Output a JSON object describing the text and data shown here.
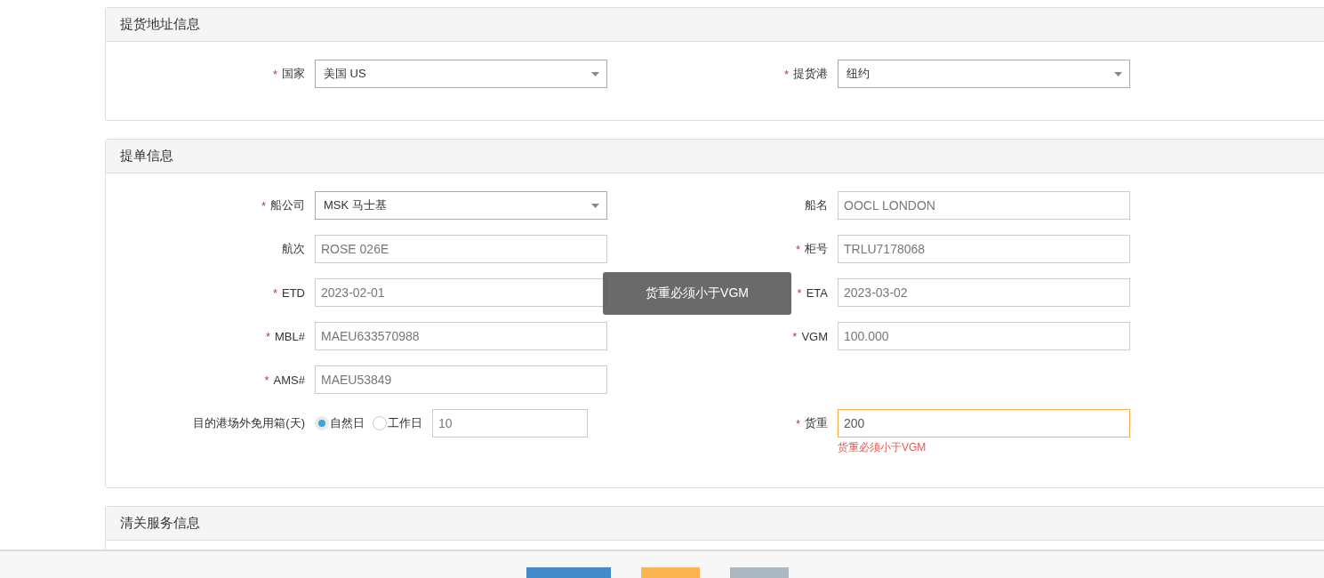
{
  "panels": [
    {
      "title": "提货地址信息",
      "rows": [
        {
          "left": {
            "kind": "select",
            "mark": "*",
            "label": "国家",
            "value": "美国 US"
          },
          "right": {
            "kind": "select",
            "mark": "*",
            "label": "提货港",
            "value": "纽约"
          }
        }
      ]
    },
    {
      "title": "提单信息",
      "rows": [
        {
          "left": {
            "kind": "select",
            "mark": "*",
            "label": "船公司",
            "value": "MSK 马士基"
          },
          "right": {
            "kind": "input",
            "label": "船名",
            "value": "OOCL LONDON"
          }
        },
        {
          "left": {
            "kind": "input",
            "label": "航次",
            "value": "ROSE 026E"
          },
          "right": {
            "kind": "input",
            "mark": "*",
            "label": "柜号",
            "value": "TRLU7178068"
          }
        },
        {
          "left": {
            "kind": "input",
            "mark": "*",
            "label": "ETD",
            "value": "2023-02-01"
          },
          "right": {
            "kind": "input",
            "mark": "*",
            "label": "ETA",
            "value": "2023-03-02"
          }
        },
        {
          "left": {
            "kind": "input",
            "mark": "*",
            "label": "MBL#",
            "value": "MAEU633570988"
          },
          "right": {
            "kind": "input",
            "mark": "*",
            "label": "VGM",
            "value": "100.000"
          }
        },
        {
          "left": {
            "kind": "input",
            "mark": "*",
            "label": "AMS#",
            "value": "MAEU53849"
          }
        },
        {
          "left": {
            "kind": "radio",
            "label": "目的港场外免用箱(天)",
            "options": [
              {
                "label": "自然日",
                "selected": true
              },
              {
                "label": "工作日",
                "selected": false
              }
            ],
            "value": "10"
          },
          "right": {
            "kind": "input",
            "mark": "*",
            "label": "货重",
            "value": "200",
            "invalid": true,
            "error": "货重必须小于VGM"
          }
        }
      ]
    },
    {
      "title": "清关服务信息"
    }
  ],
  "toast": {
    "text": "货重必须小于VGM"
  },
  "footer": {
    "buttons": [
      {
        "kind": "primary"
      },
      {
        "kind": "warning"
      },
      {
        "kind": "default"
      }
    ]
  }
}
